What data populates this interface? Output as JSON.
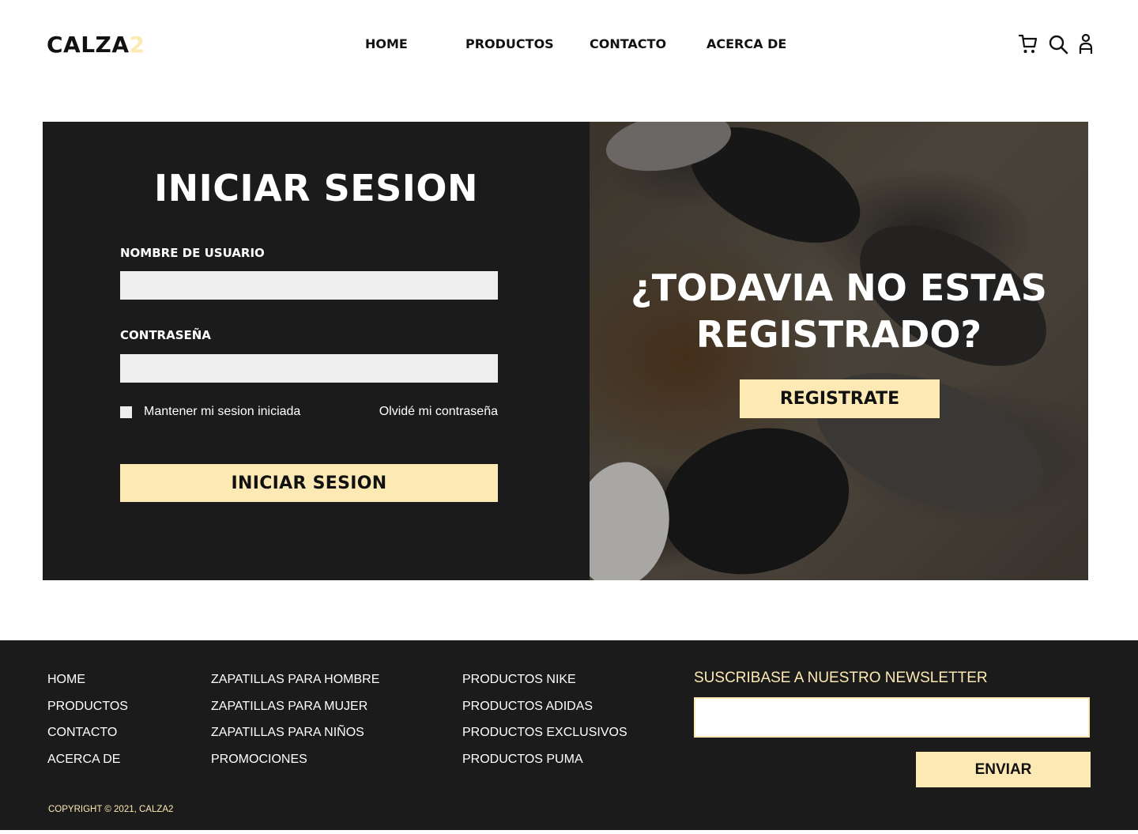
{
  "header": {
    "logo_main": "CALZA",
    "logo_accent": "2",
    "nav": [
      "HOME",
      "PRODUCTOS",
      "CONTACTO",
      "ACERCA DE"
    ],
    "icons": [
      "cart-icon",
      "search-icon",
      "user-icon"
    ]
  },
  "login": {
    "title": "INICIAR SESION",
    "username_label": "NOMBRE DE USUARIO",
    "username_value": "",
    "password_label": "CONTRASEÑA",
    "password_value": "",
    "remember_label": "Mantener mi sesion iniciada",
    "remember_checked": false,
    "forgot_label": "Olvidé mi contraseña",
    "submit_label": "INICIAR SESION"
  },
  "promo": {
    "title_line1": "¿TODAVIA NO ESTAS",
    "title_line2": "REGISTRADO?",
    "button_label": "REGISTRATE"
  },
  "footer": {
    "col1": [
      "HOME",
      "PRODUCTOS",
      "CONTACTO",
      "ACERCA DE"
    ],
    "col2": [
      "ZAPATILLAS PARA HOMBRE",
      "ZAPATILLAS PARA MUJER",
      "ZAPATILLAS PARA NIÑOS",
      "PROMOCIONES"
    ],
    "col3": [
      "PRODUCTOS NIKE",
      "PRODUCTOS ADIDAS",
      "PRODUCTOS EXCLUSIVOS",
      "PRODUCTOS PUMA"
    ],
    "newsletter_title": "SUSCRIBASE A NUESTRO NEWSLETTER",
    "newsletter_value": "",
    "send_label": "ENVIAR",
    "copyright": "COPYRIGHT © 2021, CALZA2"
  },
  "colors": {
    "accent": "#fde9b3",
    "dark": "#1b1b1b",
    "input_bg": "#eeeeee"
  }
}
